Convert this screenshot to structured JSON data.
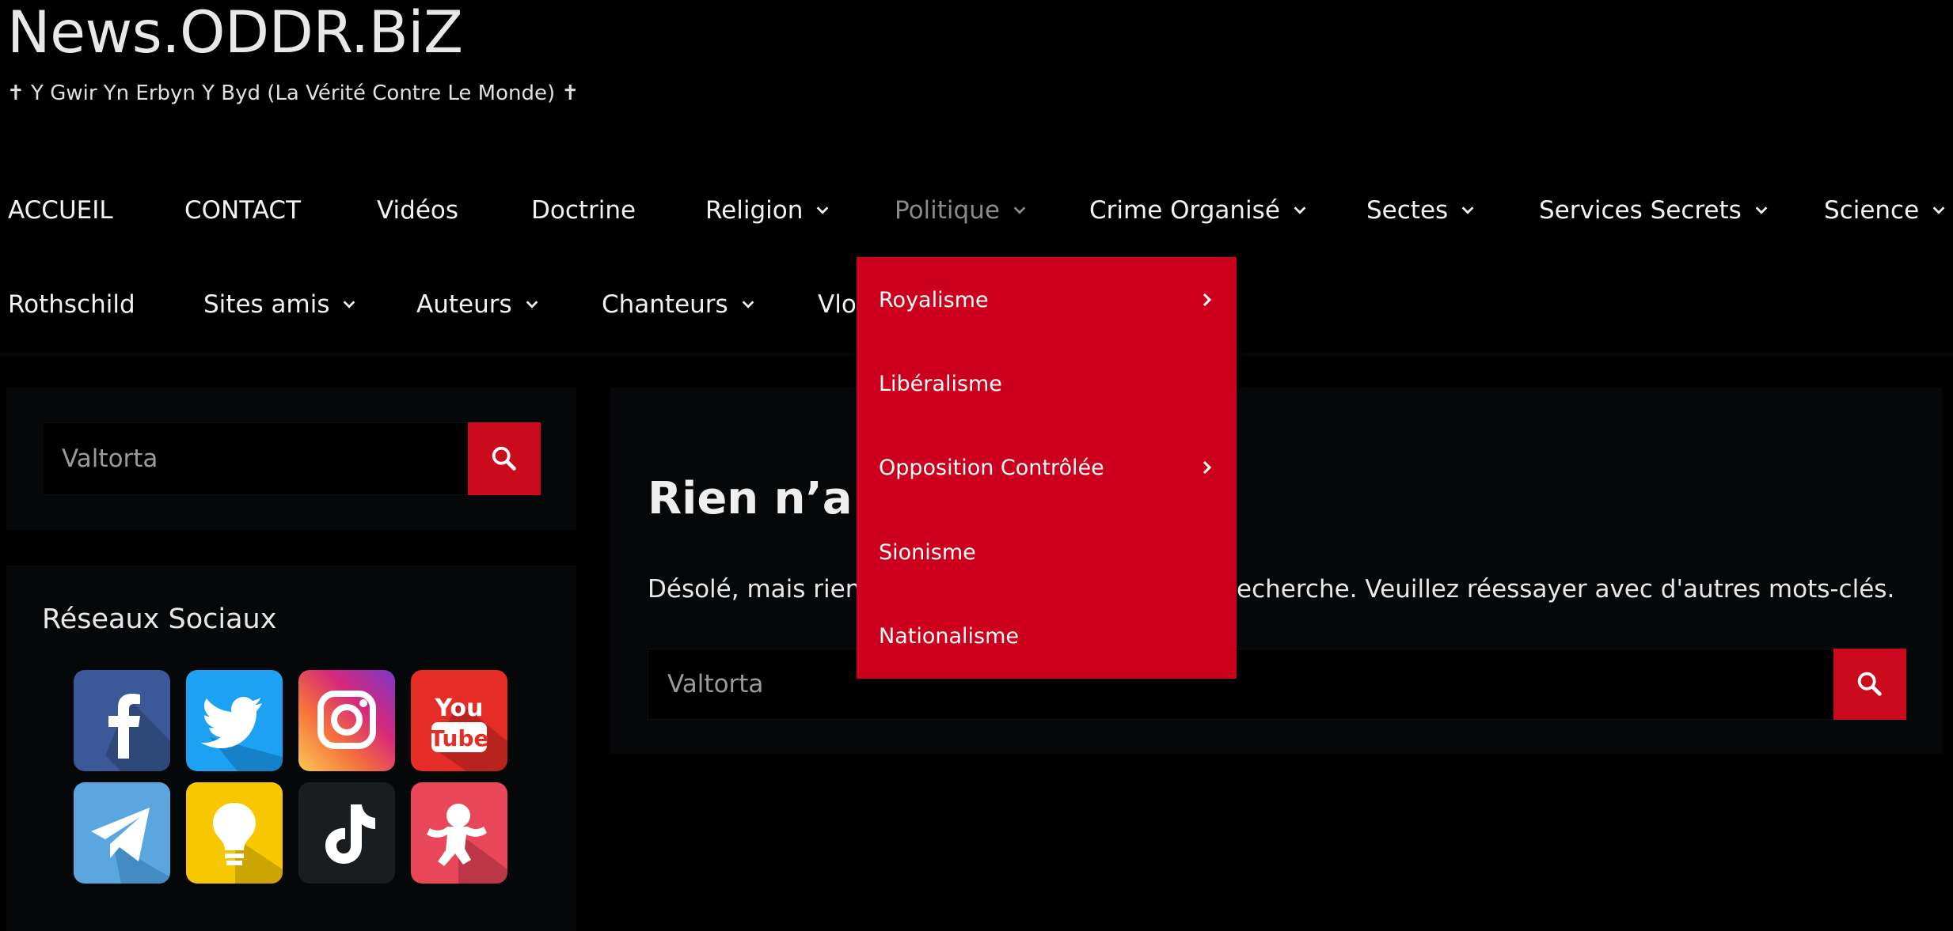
{
  "site": {
    "title": "News.ODDR.BiZ",
    "description": "✝ Y Gwir Yn Erbyn Y Byd (La Vérité Contre Le Monde) ✝"
  },
  "nav": {
    "row1": [
      {
        "label": "ACCUEIL",
        "has_submenu": false
      },
      {
        "label": "CONTACT",
        "has_submenu": false
      },
      {
        "label": "Vidéos",
        "has_submenu": false
      },
      {
        "label": "Doctrine",
        "has_submenu": false
      },
      {
        "label": "Religion",
        "has_submenu": true
      },
      {
        "label": "Politique",
        "has_submenu": true,
        "active": true
      },
      {
        "label": "Crime Organisé",
        "has_submenu": true
      },
      {
        "label": "Sectes",
        "has_submenu": true
      },
      {
        "label": "Services Secrets",
        "has_submenu": true
      },
      {
        "label": "Science",
        "has_submenu": true
      }
    ],
    "row2": [
      {
        "label": "Rothschild",
        "has_submenu": false
      },
      {
        "label": "Sites amis",
        "has_submenu": true
      },
      {
        "label": "Auteurs",
        "has_submenu": true
      },
      {
        "label": "Chanteurs",
        "has_submenu": true
      },
      {
        "label": "Vlo",
        "has_submenu": false
      }
    ]
  },
  "dropdown": {
    "parent": "Politique",
    "items": [
      {
        "label": "Royalisme",
        "has_submenu": true
      },
      {
        "label": "Libéralisme",
        "has_submenu": false
      },
      {
        "label": "Opposition Contrôlée",
        "has_submenu": true
      },
      {
        "label": "Sionisme",
        "has_submenu": false
      },
      {
        "label": "Nationalisme",
        "has_submenu": false
      }
    ]
  },
  "sidebar": {
    "search": {
      "value": "Valtorta"
    },
    "social": {
      "title": "Réseaux Sociaux",
      "icons": [
        "facebook-icon",
        "twitter-icon",
        "instagram-icon",
        "youtube-icon",
        "telegram-icon",
        "lightbulb-icon",
        "tiktok-icon",
        "astronaut-icon"
      ]
    }
  },
  "main": {
    "title": "Rien n’a é",
    "message_start": "Désolé, mais rien n",
    "message_end": "echerche. Veuillez réessayer avec d'autres mots-clés.",
    "search": {
      "value": "Valtorta"
    }
  },
  "colors": {
    "accent": "#cc001c",
    "background": "#000000",
    "panel": "#050708",
    "active_nav": "#8a8a8a"
  }
}
